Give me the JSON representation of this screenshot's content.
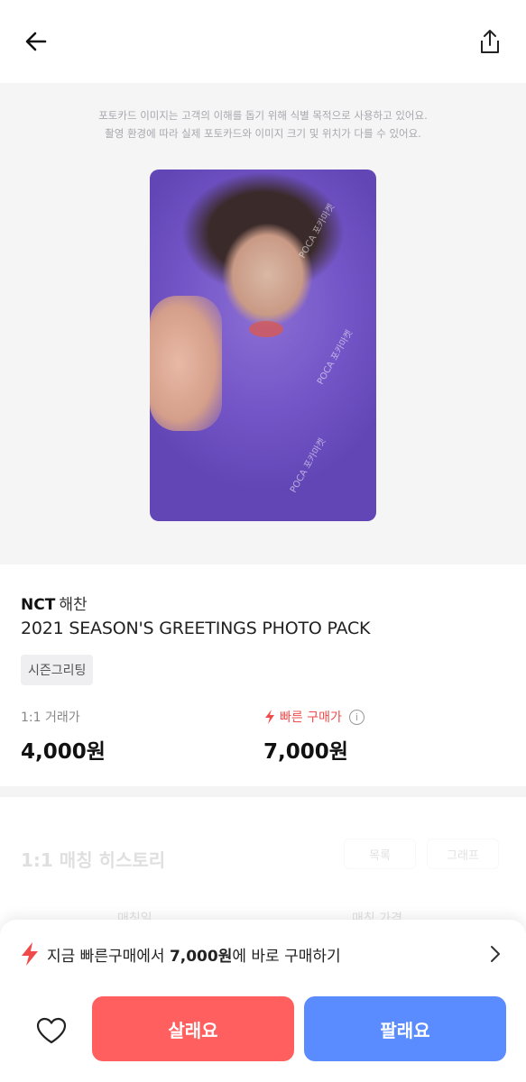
{
  "header": {
    "back_icon": "arrow-left-icon",
    "share_icon": "share-icon"
  },
  "image_notice": {
    "line1": "포토카드 이미지는 고객의 이해를 돕기 위해 식별 목적으로 사용하고 있어요.",
    "line2": "촬영 환경에 따라 실제 포토카드와 이미지 크기 및 위치가 다를 수 있어요."
  },
  "photocard": {
    "watermark": "POCA 포카마켓"
  },
  "product": {
    "group": "NCT",
    "member": "해찬",
    "title": "2021 SEASON'S GREETINGS PHOTO PACK",
    "tag": "시즌그리팅"
  },
  "prices": {
    "trade_label": "1:1 거래가",
    "trade_value": "4,000원",
    "fast_label": "빠른 구매가",
    "fast_value": "7,000원",
    "fast_icon": "lightning-icon",
    "info_icon": "info-icon"
  },
  "history": {
    "title": "1:1 매칭 히스토리",
    "tab_list": "목록",
    "tab_graph": "그래프",
    "col_date": "매칭일",
    "col_price": "매칭 가격"
  },
  "bottom_sheet": {
    "quick_prefix": "지금 빠른구매에서 ",
    "quick_price": "7,000원",
    "quick_suffix": "에 바로 구매하기",
    "buy_label": "살래요",
    "sell_label": "팔래요"
  },
  "colors": {
    "buy": "#ff5f5f",
    "sell": "#5b8cff",
    "fast": "#f04b4b"
  }
}
